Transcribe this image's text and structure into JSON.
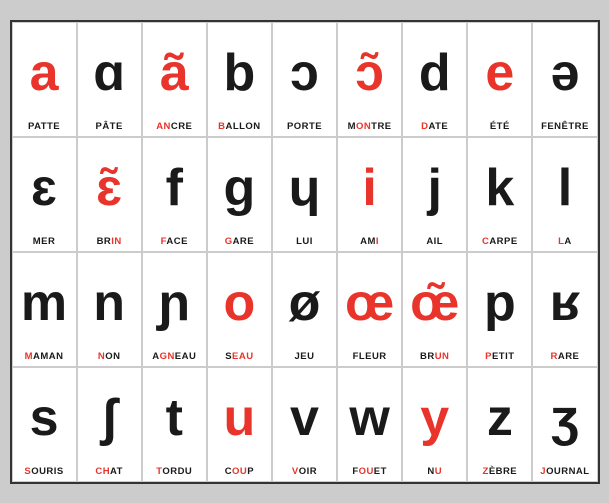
{
  "cells": [
    {
      "symbol": "a",
      "color": "red",
      "word": "PATTE",
      "highlight": ""
    },
    {
      "symbol": "ɑ",
      "color": "black",
      "word": "PÂTE",
      "highlight": ""
    },
    {
      "symbol": "ã",
      "color": "red",
      "word": "ANCRE",
      "highlight": "AN",
      "hlPos": "start",
      "hlLen": 2
    },
    {
      "symbol": "b",
      "color": "black",
      "word": "BALLON",
      "highlight": "B",
      "hlPos": "start",
      "hlLen": 1
    },
    {
      "symbol": "ɔ",
      "color": "black",
      "word": "PORTE",
      "highlight": ""
    },
    {
      "symbol": "ɔ̃",
      "color": "red",
      "word": "MONTRE",
      "highlight": "ON",
      "hlPos": 1,
      "hlLen": 2
    },
    {
      "symbol": "d",
      "color": "black",
      "word": "DATE",
      "highlight": "D",
      "hlPos": "start",
      "hlLen": 1
    },
    {
      "symbol": "e",
      "color": "red",
      "word": "ÉTÉ",
      "highlight": ""
    },
    {
      "symbol": "ə",
      "color": "black",
      "word": "FENÊTRE",
      "highlight": ""
    },
    {
      "symbol": "ɛ",
      "color": "black",
      "word": "MER",
      "highlight": ""
    },
    {
      "symbol": "ɛ̃",
      "color": "red",
      "word": "BRIN",
      "highlight": "IN",
      "hlPos": 2,
      "hlLen": 2
    },
    {
      "symbol": "f",
      "color": "black",
      "word": "FACE",
      "highlight": "F",
      "hlPos": "start",
      "hlLen": 1
    },
    {
      "symbol": "g",
      "color": "black",
      "word": "GARE",
      "highlight": "G",
      "hlPos": "start",
      "hlLen": 1
    },
    {
      "symbol": "ɥ",
      "color": "black",
      "word": "LUI",
      "highlight": ""
    },
    {
      "symbol": "i",
      "color": "red",
      "word": "AMI",
      "highlight": "I",
      "hlPos": "end",
      "hlLen": 1
    },
    {
      "symbol": "j",
      "color": "black",
      "word": "AIL",
      "highlight": ""
    },
    {
      "symbol": "k",
      "color": "black",
      "word": "CARPE",
      "highlight": "C",
      "hlPos": "start",
      "hlLen": 1
    },
    {
      "symbol": "l",
      "color": "black",
      "word": "LA",
      "highlight": "L",
      "hlPos": "start",
      "hlLen": 1
    },
    {
      "symbol": "m",
      "color": "black",
      "word": "MAMAN",
      "highlight": "M",
      "hlPos": "start",
      "hlLen": 1
    },
    {
      "symbol": "n",
      "color": "black",
      "word": "NON",
      "highlight": "N",
      "hlPos": "start",
      "hlLen": 1
    },
    {
      "symbol": "ɲ",
      "color": "black",
      "word": "AGNEAU",
      "highlight": "GN",
      "hlPos": 2,
      "hlLen": 2
    },
    {
      "symbol": "o",
      "color": "red",
      "word": "SEAU",
      "highlight": "EAU",
      "hlPos": 1,
      "hlLen": 3
    },
    {
      "symbol": "ø",
      "color": "black",
      "word": "JEU",
      "highlight": ""
    },
    {
      "symbol": "œ",
      "color": "red",
      "word": "FLEUR",
      "highlight": ""
    },
    {
      "symbol": "œ̃",
      "color": "red",
      "word": "BRUN",
      "highlight": "UN",
      "hlPos": 2,
      "hlLen": 2
    },
    {
      "symbol": "p",
      "color": "black",
      "word": "PETIT",
      "highlight": "P",
      "hlPos": "start",
      "hlLen": 1
    },
    {
      "symbol": "ʁ",
      "color": "black",
      "word": "RARE",
      "highlight": "R",
      "hlPos": "start",
      "hlLen": 1
    },
    {
      "symbol": "s",
      "color": "black",
      "word": "SOURIS",
      "highlight": "S",
      "hlPos": "start",
      "hlLen": 1
    },
    {
      "symbol": "ʃ",
      "color": "black",
      "word": "CHAT",
      "highlight": "CH",
      "hlPos": "start",
      "hlLen": 2
    },
    {
      "symbol": "t",
      "color": "black",
      "word": "TORDU",
      "highlight": "T",
      "hlPos": "start",
      "hlLen": 1
    },
    {
      "symbol": "u",
      "color": "red",
      "word": "COUP",
      "highlight": "OU",
      "hlPos": 1,
      "hlLen": 2
    },
    {
      "symbol": "v",
      "color": "black",
      "word": "VOIR",
      "highlight": "V",
      "hlPos": "start",
      "hlLen": 1
    },
    {
      "symbol": "w",
      "color": "black",
      "word": "FOUET",
      "highlight": "OU",
      "hlPos": 1,
      "hlLen": 2
    },
    {
      "symbol": "y",
      "color": "red",
      "word": "NU",
      "highlight": "U",
      "hlPos": "end",
      "hlLen": 1
    },
    {
      "symbol": "z",
      "color": "black",
      "word": "ZÈBRE",
      "highlight": "Z",
      "hlPos": "start",
      "hlLen": 1
    },
    {
      "symbol": "ʒ",
      "color": "black",
      "word": "JOURNAL",
      "highlight": "J",
      "hlPos": "start",
      "hlLen": 1
    }
  ]
}
